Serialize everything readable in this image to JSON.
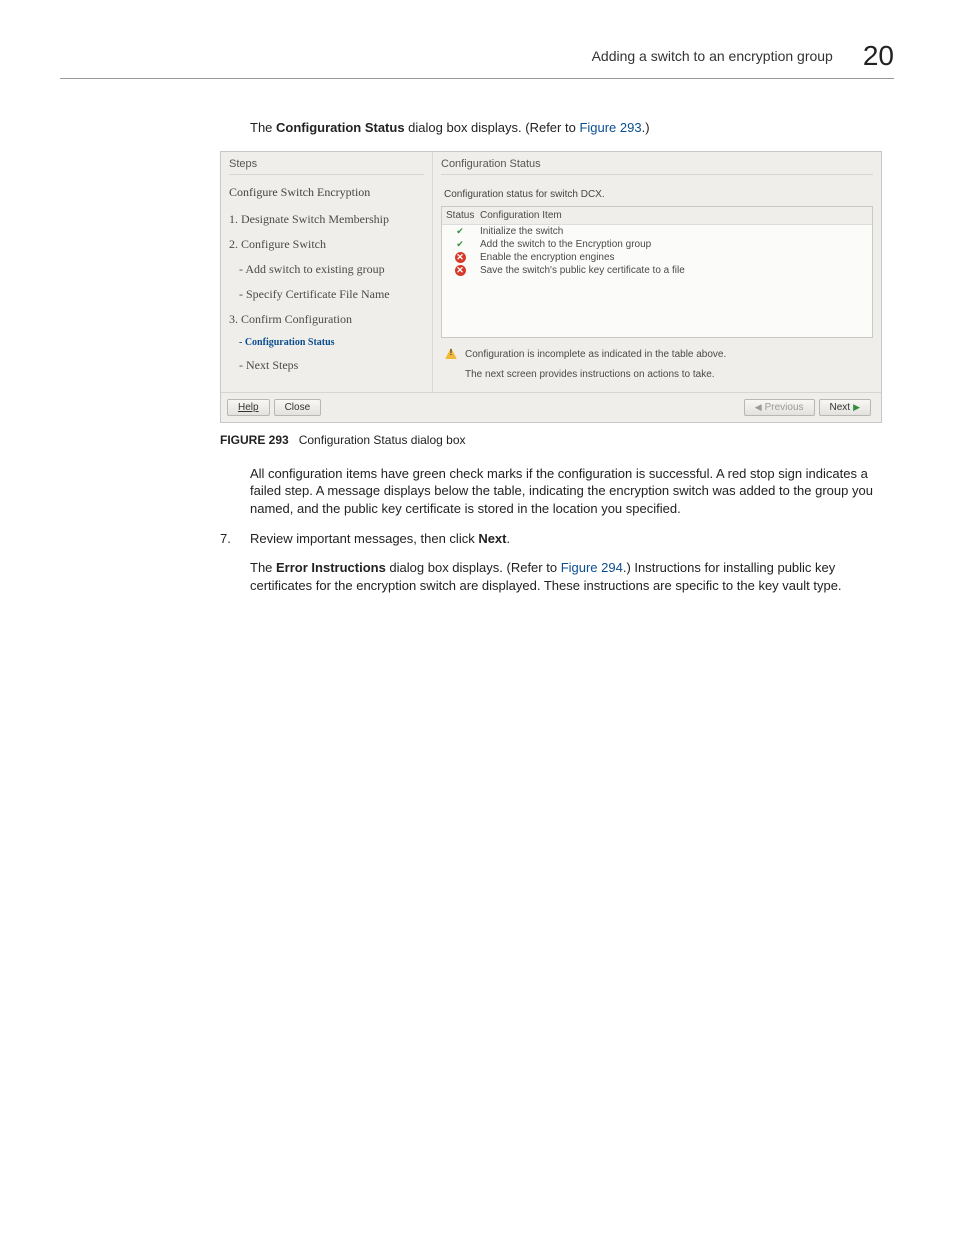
{
  "header": {
    "title": "Adding a switch to an encryption group",
    "chapter": "20"
  },
  "intro": {
    "pre": "The ",
    "bold": "Configuration Status",
    "mid": " dialog box displays. (Refer to ",
    "link": "Figure 293",
    "post": ".)"
  },
  "dialog": {
    "steps_label": "Steps",
    "status_label": "Configuration Status",
    "steps_heading": "Configure Switch Encryption",
    "steps": [
      {
        "label": "1. Designate Switch Membership"
      },
      {
        "label": "2. Configure Switch"
      }
    ],
    "substeps": [
      {
        "label": "- Add switch to existing group"
      },
      {
        "label": "- Specify Certificate File Name"
      }
    ],
    "step3": "3. Confirm Configuration",
    "current": "- Configuration Status",
    "next_steps": "- Next Steps",
    "subtitle": "Configuration status for switch DCX.",
    "table": {
      "h1": "Status",
      "h2": "Configuration Item",
      "rows": [
        {
          "status": "ok",
          "item": "Initialize the switch"
        },
        {
          "status": "ok",
          "item": "Add the switch to the Encryption group"
        },
        {
          "status": "fail",
          "item": "Enable the encryption engines"
        },
        {
          "status": "fail",
          "item": "Save the switch's public key certificate to a file"
        }
      ]
    },
    "warning_line1": "Configuration is incomplete as indicated in the table above.",
    "warning_line2": "The next screen provides instructions on actions to take.",
    "buttons": {
      "help": "Help",
      "close": "Close",
      "previous": "Previous",
      "next": "Next"
    }
  },
  "caption": {
    "label": "FIGURE 293",
    "text": "Configuration Status dialog box"
  },
  "para1": "All configuration items have green check marks if the configuration is successful. A red stop sign indicates a failed step. A message displays below the table, indicating the encryption switch was added to the group you named, and the public key certificate is stored in the location you specified.",
  "step7": {
    "num": "7.",
    "text_pre": "Review important messages, then click ",
    "bold": "Next",
    "text_post": "."
  },
  "para2": {
    "pre": "The ",
    "bold": "Error Instructions",
    "mid": " dialog box displays. (Refer to ",
    "link": "Figure 294",
    "post": ".) Instructions for installing public key certificates for the encryption switch are displayed. These instructions are specific to the key vault type."
  }
}
